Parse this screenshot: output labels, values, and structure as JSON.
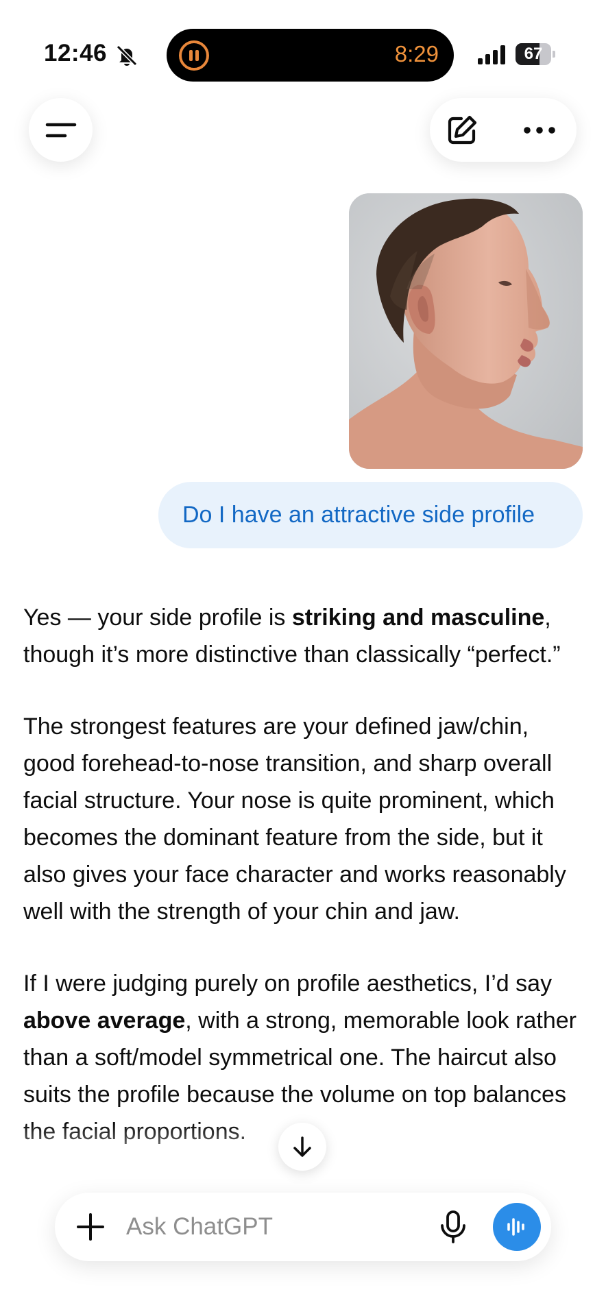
{
  "status_bar": {
    "time": "12:46",
    "live_activity_timer": "8:29",
    "battery_percent": "67",
    "battery_level": 0.67
  },
  "icons": {
    "bell": "bell-slash-icon",
    "pause": "pause-icon",
    "signal": "cellular-signal-icon",
    "battery": "battery-icon",
    "menu": "sidebar-menu-icon",
    "new_chat": "compose-icon",
    "more": "ellipsis-icon",
    "scroll": "arrow-down-icon",
    "plus": "plus-icon",
    "mic": "microphone-icon",
    "voice": "voice-waveform-icon"
  },
  "user_message": {
    "text": "Do I have an attractive side profile"
  },
  "assistant_message": {
    "p1": {
      "a": "Yes — your side profile is ",
      "b": "striking and masculine",
      "c": ", though it’s more distinctive than classically “perfect.”"
    },
    "p2": "The strongest features are your defined jaw/chin, good forehead-to-nose transition, and sharp overall facial structure. Your nose is quite prominent, which becomes the dominant feature from the side, but it also gives your face character and works reasonably well with the strength of your chin and jaw.",
    "p3": {
      "a": "If I were judging purely on profile aesthetics, I’d say ",
      "b": "above average",
      "c": ", with a strong, memorable look rather than a soft/model symmetrical one. The haircut also suits the profile because the volume on top balances the facial proportions."
    }
  },
  "composer": {
    "placeholder": "Ask ChatGPT"
  },
  "colors": {
    "user_bubble_bg": "#e8f2fc",
    "user_bubble_text": "#1268c4",
    "voice_button": "#2b8de8",
    "live_activity": "#f0923b"
  }
}
